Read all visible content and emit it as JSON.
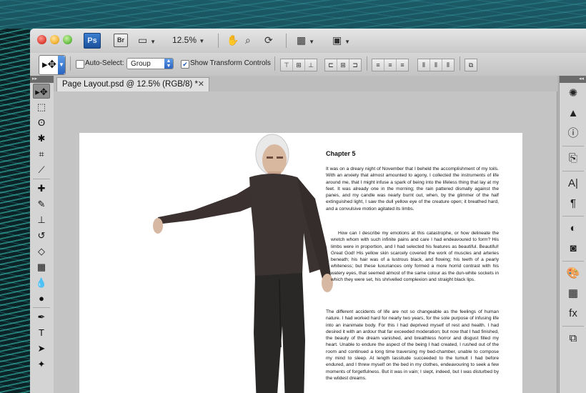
{
  "app": {
    "logo": "Ps",
    "bridge": "Br",
    "zoom": "12.5%"
  },
  "titlebar_icons": [
    "hand-icon",
    "zoom-icon",
    "rotate-view-icon",
    "arrange-documents-icon",
    "screen-mode-icon"
  ],
  "options": {
    "auto_select_label": "Auto-Select:",
    "auto_select_checked": false,
    "auto_select_target": "Group",
    "show_transform_label": "Show Transform Controls",
    "show_transform_checked": true
  },
  "document": {
    "tab_title": "Page Layout.psd @ 12.5% (RGB/8) *",
    "close_glyph": "✕"
  },
  "page_text": {
    "chapter": "Chapter 5",
    "p1": "It was on a dreary night of November that I beheld the accomplishment of my toils. With an anxiety that almost amounted to agony, I collected the instruments of life around me, that I might infuse a spark of being into the lifeless thing that lay at my feet. It was already one in the morning; the rain pattered dismally against the panes, and my candle was nearly burnt out, when, by the glimmer of the half extinguished light, I saw the dull yellow eye of the creature open; it breathed hard, and a convulsive motion agitated its limbs.",
    "p2": "How can I describe my emotions at this catastrophe, or how delineate the wretch whom with such infinite pains and care I had endeavoured to form? His limbs were in proportion, and I had selected his features as beautiful. Beautiful! Great God! His yellow skin scarcely covered the work of muscles and arteries beneath; his hair was of a lustrous black, and flowing; his teeth of a pearly whiteness; but these luxuriances only formed a more horrid contrast with his watery eyes, that seemed almost of the same colour as the dun-white sockets in which they were set, his shrivelled complexion and straight black lips.",
    "p3": "The different accidents of life are not so changeable as the feelings of human nature. I had worked hard for nearly two years, for the sole purpose of infusing life into an inanimate body. For this I had deprived myself of rest and health. I had desired it with an ardour that far exceeded moderation; but now that I had finished, the beauty of the dream vanished, and breathless horror and disgust filled my heart. Unable to endure the aspect of the being I had created, I rushed out of the room and continued a long time traversing my bed-chamber, unable to compose my mind to sleep. At length lassitude succeeded to the tumult I had before endured, and I threw myself on the bed in my clothes, endeavouring to seek a few moments of forgetfulness. But it was in vain; I slept, indeed, but I was disturbed by the wildest dreams."
  },
  "tools": [
    {
      "name": "move-tool-icon",
      "glyph": "▸✥",
      "active": true
    },
    {
      "name": "marquee-tool-icon",
      "glyph": "⬚"
    },
    {
      "name": "lasso-tool-icon",
      "glyph": "ʘ"
    },
    {
      "name": "magic-wand-tool-icon",
      "glyph": "✱"
    },
    {
      "name": "crop-tool-icon",
      "glyph": "⌗"
    },
    {
      "name": "eyedropper-tool-icon",
      "glyph": "⟋"
    },
    {
      "name": "healing-brush-tool-icon",
      "glyph": "✚"
    },
    {
      "name": "brush-tool-icon",
      "glyph": "✎"
    },
    {
      "name": "clone-stamp-tool-icon",
      "glyph": "⊥"
    },
    {
      "name": "history-brush-tool-icon",
      "glyph": "↺"
    },
    {
      "name": "eraser-tool-icon",
      "glyph": "◇"
    },
    {
      "name": "gradient-tool-icon",
      "glyph": "▦"
    },
    {
      "name": "blur-tool-icon",
      "glyph": "💧"
    },
    {
      "name": "dodge-tool-icon",
      "glyph": "●"
    },
    {
      "name": "pen-tool-icon",
      "glyph": "✒"
    },
    {
      "name": "type-tool-icon",
      "glyph": "T"
    },
    {
      "name": "path-selection-tool-icon",
      "glyph": "➤"
    },
    {
      "name": "shape-tool-icon",
      "glyph": "✦"
    }
  ],
  "dock_icons": [
    {
      "name": "navigator-panel-icon",
      "glyph": "✺"
    },
    {
      "name": "histogram-panel-icon",
      "glyph": "▲"
    },
    {
      "name": "info-panel-icon",
      "glyph": "ⓘ"
    },
    {
      "name": "clone-source-panel-icon",
      "glyph": "⎘"
    },
    {
      "name": "character-panel-icon",
      "glyph": "A|"
    },
    {
      "name": "paragraph-panel-icon",
      "glyph": "¶"
    },
    {
      "name": "adjustments-panel-icon",
      "glyph": "◐"
    },
    {
      "name": "masks-panel-icon",
      "glyph": "◙"
    },
    {
      "name": "color-panel-icon",
      "glyph": "🎨"
    },
    {
      "name": "swatches-panel-icon",
      "glyph": "▦"
    },
    {
      "name": "styles-panel-icon",
      "glyph": "fx"
    },
    {
      "name": "layers-panel-icon",
      "glyph": "⧉"
    }
  ]
}
